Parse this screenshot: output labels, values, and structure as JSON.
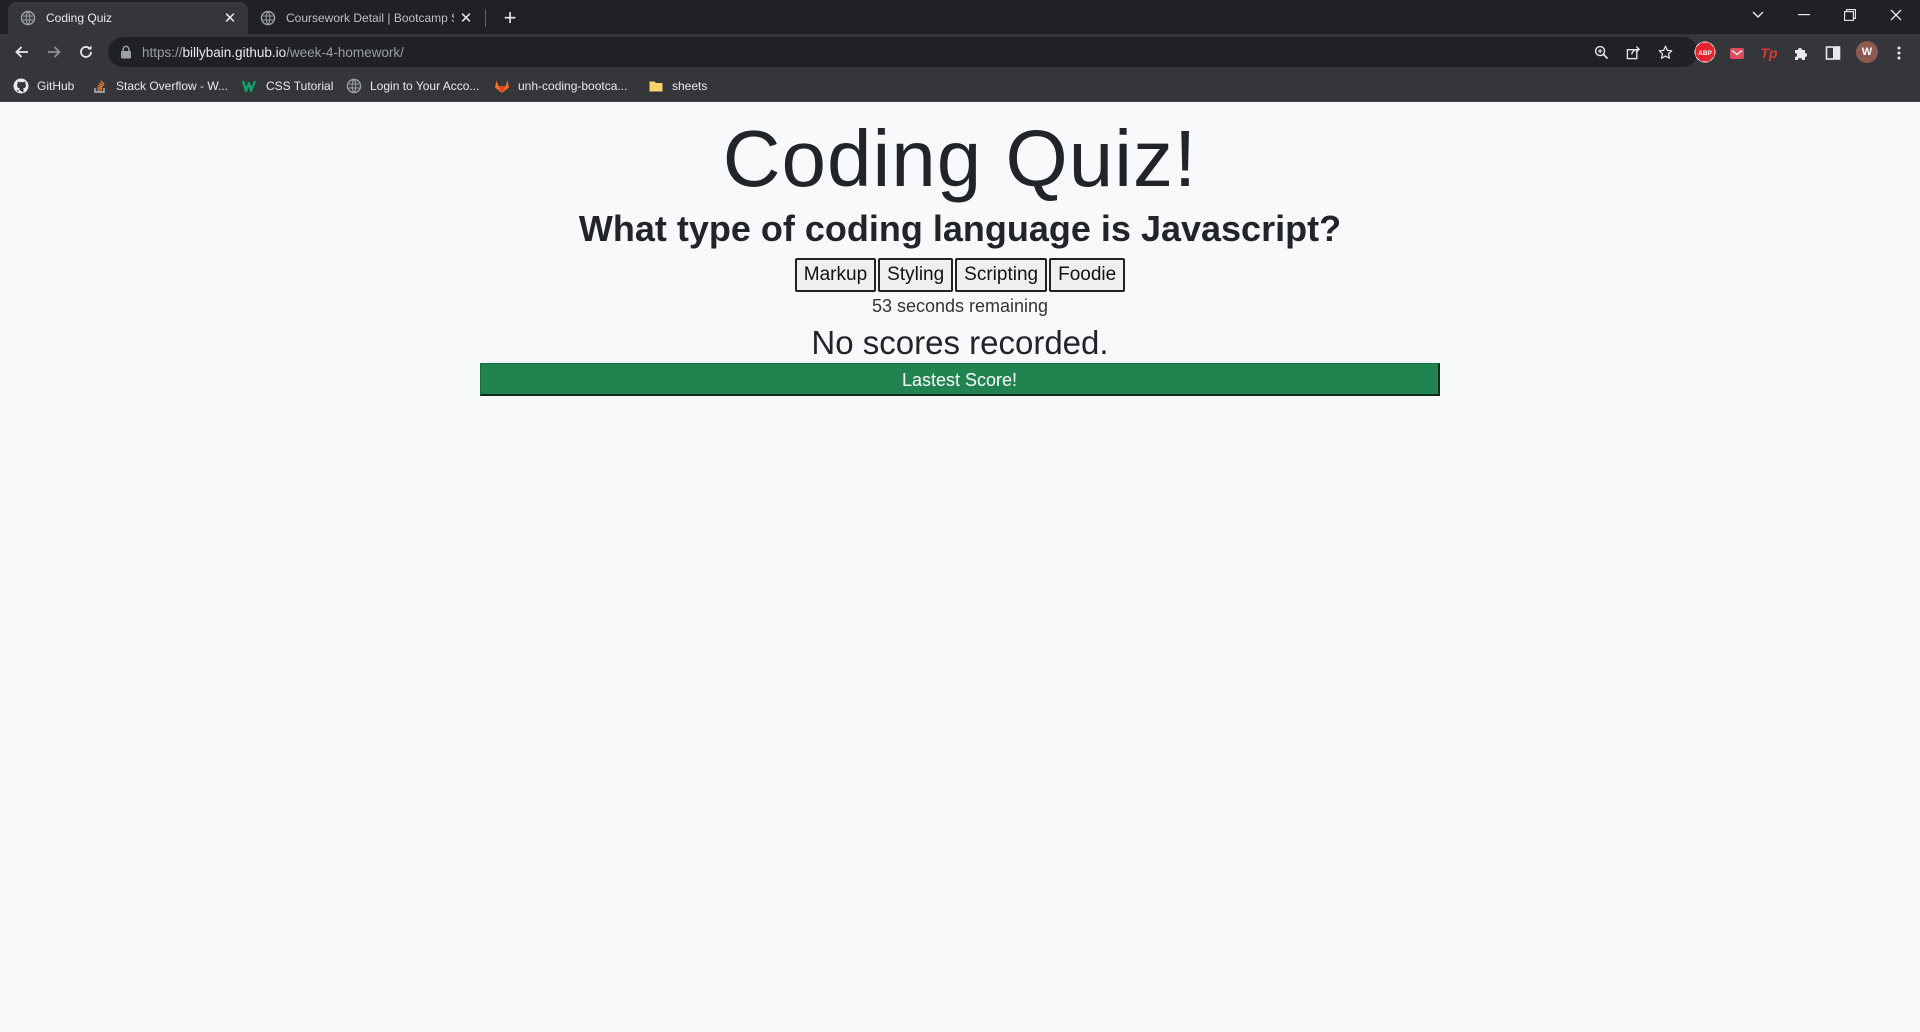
{
  "browser": {
    "tabs": [
      {
        "title": "Coding Quiz",
        "active": true
      },
      {
        "title": "Coursework Detail | Bootcamp Sp",
        "active": false
      }
    ],
    "url": {
      "scheme": "https://",
      "host": "billybain.github.io",
      "path": "/week-4-homework/"
    },
    "bookmarks": [
      {
        "label": "GitHub",
        "icon": "github-icon"
      },
      {
        "label": "Stack Overflow - W...",
        "icon": "stackoverflow-icon"
      },
      {
        "label": "CSS Tutorial",
        "icon": "w3schools-icon"
      },
      {
        "label": "Login to Your Acco...",
        "icon": "globe-icon"
      },
      {
        "label": "unh-coding-bootca...",
        "icon": "gitlab-icon"
      },
      {
        "label": "sheets",
        "icon": "folder-icon"
      }
    ],
    "extensions": [
      {
        "name": "abp",
        "label": "ABP"
      },
      {
        "name": "mail",
        "label": ""
      },
      {
        "name": "tp",
        "label": "Tp"
      }
    ],
    "profile_initial": "W"
  },
  "page": {
    "title": "Coding Quiz!",
    "question": "What type of coding language is Javascript?",
    "answers": [
      "Markup",
      "Styling",
      "Scripting",
      "Foodie"
    ],
    "timer": "53 seconds remaining",
    "scores_message": "No scores recorded.",
    "latest_score_button": "Lastest Score!"
  },
  "colors": {
    "accent": "#218450",
    "page_bg": "#f8f9fa",
    "chrome_dark": "#202124",
    "chrome_toolbar": "#35363a"
  }
}
